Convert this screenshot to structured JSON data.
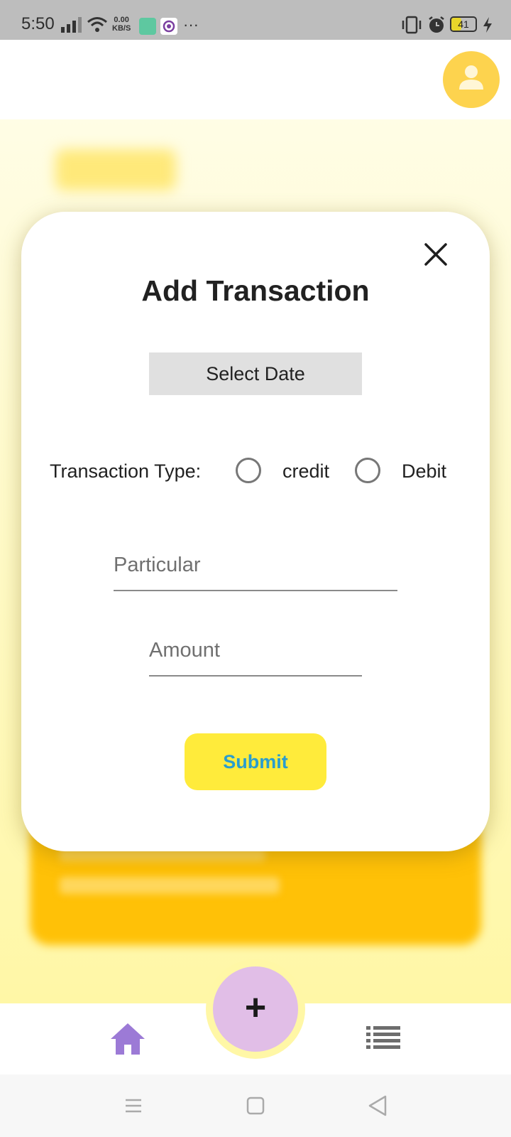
{
  "status_bar": {
    "time": "5:50",
    "net_speed_value": "0.00",
    "net_speed_unit": "KB/S",
    "battery": "41",
    "battery_level": 41,
    "icons": [
      "signal-icon",
      "wifi-icon",
      "app-notification-icon",
      "app-notification-icon",
      "more-dots-icon",
      "vibrate-icon",
      "alarm-icon",
      "battery-icon",
      "charging-icon"
    ],
    "overflow": "···"
  },
  "header": {
    "avatar_icon": "person-icon",
    "avatar_color": "#fdd34e"
  },
  "dialog": {
    "title": "Add Transaction",
    "close_icon": "close-icon",
    "select_date_label": "Select Date",
    "transaction_type_label": "Transaction Type:",
    "radio_options": [
      {
        "label": "credit",
        "selected": false
      },
      {
        "label": "Debit",
        "selected": false
      }
    ],
    "particular_placeholder": "Particular",
    "particular_value": "",
    "amount_placeholder": "Amount",
    "amount_value": "",
    "submit_label": "Submit"
  },
  "bottom_nav": {
    "home_icon": "home-icon",
    "home_color": "#9c7ad6",
    "fab_label": "+",
    "fab_color": "#e1bee7",
    "list_icon": "list-icon"
  },
  "system_nav": {
    "icons": [
      "menu-icon",
      "square-home-icon",
      "back-triangle-icon"
    ]
  },
  "colors": {
    "accent_yellow": "#ffeb3b",
    "submit_text": "#2a9dcd",
    "background": "#fff7a6",
    "card": "#ffc107"
  }
}
